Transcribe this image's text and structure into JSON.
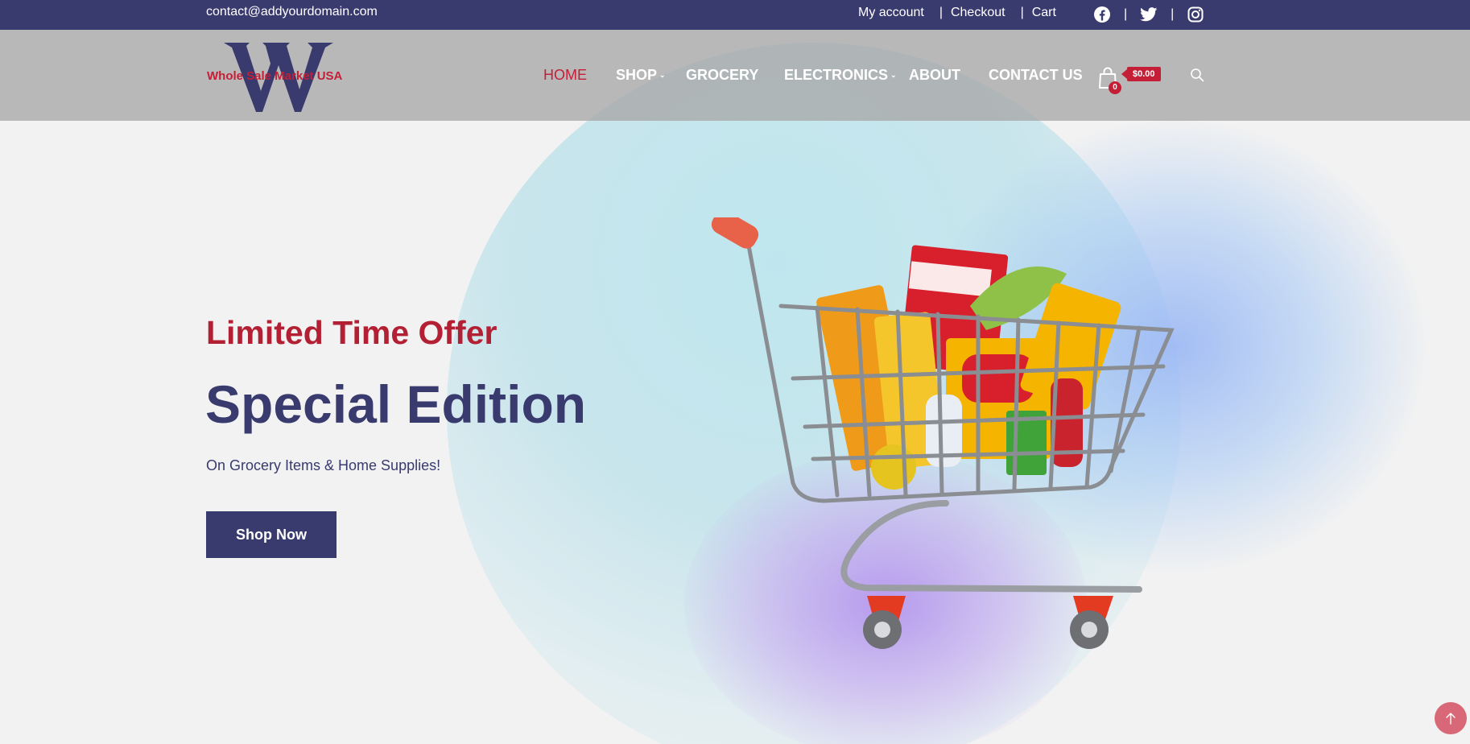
{
  "topbar": {
    "email": "contact@addyourdomain.com",
    "links": [
      {
        "label": "My account"
      },
      {
        "label": "Checkout"
      },
      {
        "label": "Cart"
      }
    ],
    "separator": "|",
    "social": [
      "facebook-icon",
      "twitter-icon",
      "instagram-icon"
    ]
  },
  "brand": {
    "logo_text": "Whole Sale Market USA",
    "logo_mark": "W"
  },
  "nav": {
    "items": [
      {
        "label": "HOME",
        "active": true
      },
      {
        "label": "SHOP",
        "dropdown": true
      },
      {
        "label": "GROCERY"
      },
      {
        "label": "ELECTRONICS",
        "dropdown": true
      },
      {
        "label": "ABOUT"
      },
      {
        "label": "CONTACT US"
      }
    ]
  },
  "cart": {
    "count": "0",
    "total": "$0.00"
  },
  "hero": {
    "kicker": "Limited Time Offer",
    "title": "Special Edition",
    "subtitle": "On Grocery Items & Home Supplies!",
    "cta": "Shop Now"
  },
  "colors": {
    "primary": "#393a6e",
    "accent": "#c41f36",
    "background": "#f2f2f2"
  }
}
